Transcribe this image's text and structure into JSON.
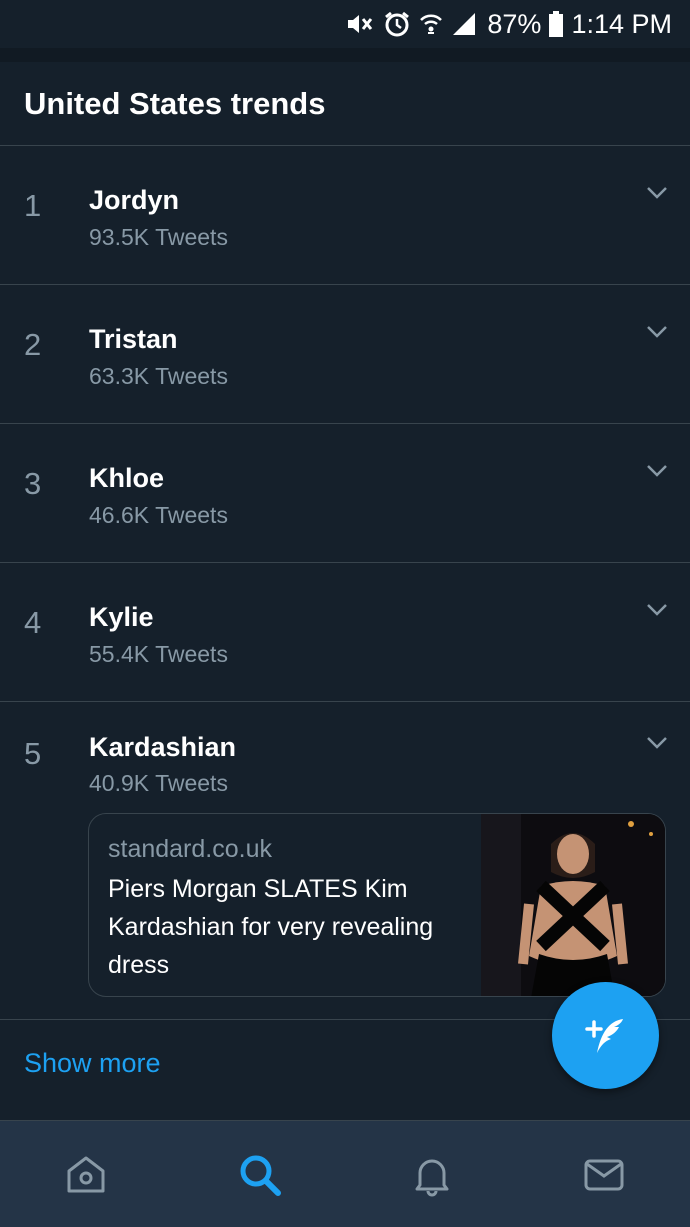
{
  "status_bar": {
    "battery": "87%",
    "time": "1:14 PM",
    "icons": [
      "mute-icon",
      "alarm-icon",
      "wifi-icon",
      "signal-icon",
      "battery-icon"
    ]
  },
  "section": {
    "title": "United States trends"
  },
  "trends": [
    {
      "rank": "1",
      "name": "Jordyn",
      "count": "93.5K Tweets"
    },
    {
      "rank": "2",
      "name": "Tristan",
      "count": "63.3K Tweets"
    },
    {
      "rank": "3",
      "name": "Khloe",
      "count": "46.6K Tweets"
    },
    {
      "rank": "4",
      "name": "Kylie",
      "count": "55.4K Tweets"
    },
    {
      "rank": "5",
      "name": "Kardashian",
      "count": "40.9K Tweets"
    }
  ],
  "card": {
    "domain": "standard.co.uk",
    "headline": "Piers Morgan SLATES Kim Kardashian for very revealing dress"
  },
  "show_more": "Show more",
  "colors": {
    "background": "#15202b",
    "accent": "#1da1f2",
    "secondary_text": "#8899a6",
    "divider": "#38444d",
    "tabbar": "#243447"
  },
  "tabs": [
    {
      "icon": "home-icon",
      "active": false
    },
    {
      "icon": "search-icon",
      "active": true
    },
    {
      "icon": "notifications-icon",
      "active": false
    },
    {
      "icon": "messages-icon",
      "active": false
    }
  ],
  "fab_icon": "compose-tweet-icon"
}
